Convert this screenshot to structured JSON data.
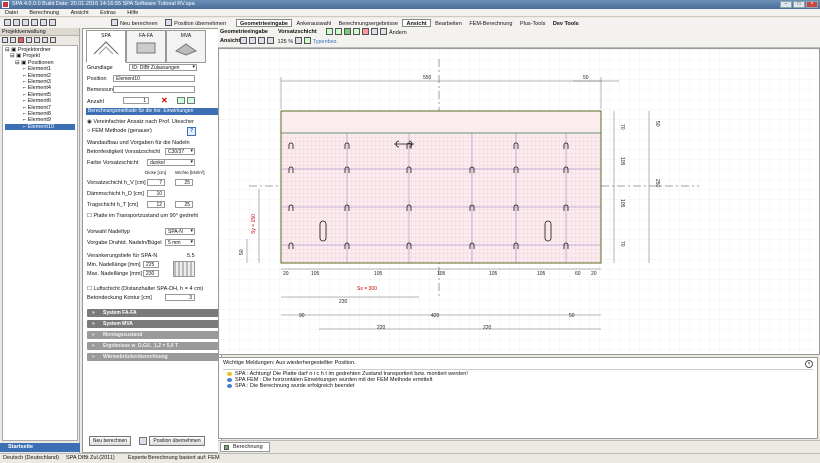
{
  "titlebar": {
    "title": "SPA 4.0.0.0    Build Date: 20.01.2016 14:16:55    SPA Software Tutorial RV.spa"
  },
  "menu": [
    "Datei",
    "Berechnung",
    "Ansicht",
    "Extras",
    "Hilfe"
  ],
  "toolbar": {
    "new_calc": "Neu berechnen",
    "apply_pos": "Position übernehmen",
    "tabs": [
      "Geometrieeingabe",
      "Ankerauswahl",
      "Berechnungsergebnisse",
      "Ansicht",
      "Bearbeiten",
      "FEM-Berechnung",
      "Plus-Tools",
      "Dev Tools"
    ],
    "active_tabs": [
      "Geometrieeingabe",
      "Ansicht"
    ]
  },
  "ribbon": {
    "geometry_label": "Geometrieeingabe",
    "vorsatz_label": "Vorsatzschicht",
    "change_label": "Ändern",
    "view_label": "Ansicht",
    "zoom": "125 %",
    "typen_label": "Typenbez."
  },
  "project": {
    "header": "Projektverwaltung",
    "root": "Projektordner",
    "project": "Projekt",
    "positions": "Positionen",
    "elements": [
      "Element1",
      "Element2",
      "Element3",
      "Element4",
      "Element5",
      "Element6",
      "Element7",
      "Element8",
      "Element9",
      "Element10"
    ],
    "footer": "Startseite"
  },
  "systems": [
    "SPA",
    "FA-FA",
    "MVA"
  ],
  "form": {
    "grundlage_label": "Grundlage",
    "grundlage_value": "ID: DIBt Zulassungen",
    "position_label": "Position",
    "position_value": "Element10",
    "bemessung_label": "Bemessung",
    "anzahl_label": "Anzahl",
    "anzahl_value": "1",
    "method_header": "Berechnungsmethode für die hor. Einwirkungen",
    "method_opt1": "Vereinfachter Ansatz nach Prof. Utescher",
    "method_opt2": "FEM Methode (genauer)",
    "help": "?",
    "wall_header": "Wandaufbau und Vorgaben für die Nadeln",
    "concrete_label": "Betonfestigkeit Vorsatzschicht",
    "concrete_value": "C30/37",
    "color_label": "Farbe Vorsatzschicht",
    "color_value": "dunkel",
    "thick_header": "Dicke [cm]",
    "density_header": "Wichte [kN/m³]",
    "vorsatz_label": "Vorsatzschicht h_V [cm]",
    "vorsatz_thick": "7",
    "vorsatz_density": "25",
    "daemm_label": "Dämmschicht h_D [cm]",
    "daemm_thick": "10",
    "trag_label": "Tragschicht h_T [cm]",
    "trag_thick": "12",
    "trag_density": "25",
    "transport_label": "Platte im Transportzustand um 90° gedreht",
    "nadeltyp_label": "Vorwahl Nadeltyp",
    "nadeltyp_value": "SPA-N",
    "vorgabe_label": "Vorgabe Drahtd. Nadeln/Bügel",
    "vorgabe_value": "5 mm",
    "verankerung_label": "Verankerungstiefe für SPA-N",
    "verankerung_value": "5.5",
    "min_label": "Min. Nadellänge [mm]",
    "min_value": "225",
    "max_label": "Max. Nadellänge [mm]",
    "max_value": "230",
    "luft_label": "Luftschicht (Distanzhalter SPA-DH, h = 4 cm)",
    "rand_label": "Betondeckung Kontur [cm]",
    "rand_value": "3",
    "groups": [
      "System FA-FA",
      "System MVA",
      "Montagezustand",
      "Ergebnisse w_D,G/L_1,2 = 5,6 T",
      "Wärmebrückenberechnung"
    ],
    "btn_calc": "Neu berechnen",
    "btn_apply": "Position übernehmen"
  },
  "drawing": {
    "dim_top": [
      "550",
      "50"
    ],
    "dim_left_labels": [
      "Sy = 150",
      "50"
    ],
    "dim_right_inner": [
      "70",
      "105",
      "105",
      "70"
    ],
    "dim_right_outer": [
      "50",
      "250"
    ],
    "dim_bottom_row": [
      "20",
      "105",
      "105",
      "105",
      "105",
      "105",
      "60",
      "20"
    ],
    "sx_label": "Sx = 300",
    "dims_below": [
      "230",
      "90",
      "420",
      "50",
      "220",
      "220"
    ]
  },
  "messages": {
    "header": "Wichtige Meldungen: Aus wiederhergestellter Position.",
    "items": [
      {
        "type": "warn",
        "text": "SPA : Achtung! Die Platte darf  n i c h t  im gedrehten Zustand transportiert bzw. montiert werden!"
      },
      {
        "type": "info",
        "text": "SPA FEM : Die horizontalen Einwirkungen wurden mit der FEM Methode ermittelt"
      },
      {
        "type": "info",
        "text": "SPA : Die Berechnung wurde erfolgreich beendet"
      }
    ],
    "tab": "Berechnung"
  },
  "statusbar": {
    "lang": "Deutsch (Deutschland)",
    "norm": "SPA DIBt Zul.(2011)",
    "mode": "Experte",
    "basis": "Berechnung basiert auf:  FEM"
  }
}
